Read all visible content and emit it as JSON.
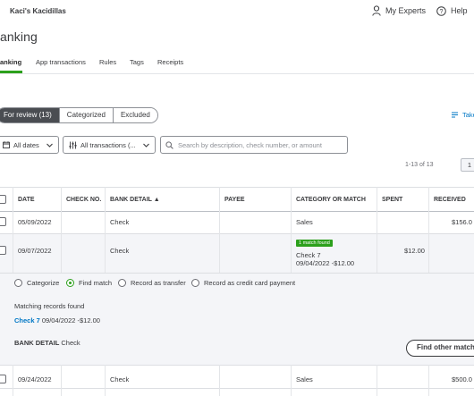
{
  "header": {
    "company": "Kaci's Kacidillas",
    "my_experts": "My Experts",
    "help": "Help"
  },
  "page": {
    "title": "anking"
  },
  "tabs": [
    {
      "label": "anking"
    },
    {
      "label": "App transactions"
    },
    {
      "label": "Rules"
    },
    {
      "label": "Tags"
    },
    {
      "label": "Receipts"
    }
  ],
  "segments": [
    {
      "label": "For review (13)"
    },
    {
      "label": "Categorized"
    },
    {
      "label": "Excluded"
    }
  ],
  "take_link": "Take",
  "filters": {
    "dates": "All dates",
    "transactions": "All transactions (...",
    "search_placeholder": "Search by description, check number, or amount"
  },
  "pager": {
    "text": "1-13 of 13",
    "page": "1"
  },
  "table": {
    "headers": [
      "DATE",
      "CHECK NO.",
      "BANK DETAIL ▲",
      "PAYEE",
      "CATEGORY OR MATCH",
      "SPENT",
      "RECEIVED"
    ],
    "rows": [
      {
        "date": "05/09/2022",
        "check_no": "",
        "bank_detail": "Check",
        "payee": "",
        "category": "Sales",
        "spent": "",
        "received": "$156.0"
      },
      {
        "date": "09/07/2022",
        "check_no": "",
        "bank_detail": "Check",
        "payee": "",
        "badge": "1 match found",
        "category": "Check 7",
        "category_sub": "09/04/2022 -$12.00",
        "spent": "$12.00",
        "received": ""
      },
      {
        "date": "09/24/2022",
        "check_no": "",
        "bank_detail": "Check",
        "payee": "",
        "category": "Sales",
        "spent": "",
        "received": "$500.0"
      }
    ]
  },
  "expanded": {
    "options": [
      "Categorize",
      "Find match",
      "Record as transfer",
      "Record as credit card payment"
    ],
    "selected": "Find match",
    "matching_title": "Matching records found",
    "match_link": "Check 7",
    "match_detail": "09/04/2022 -$12.00",
    "bank_detail_label": "BANK DETAIL",
    "bank_detail_value": "Check",
    "find_other": "Find other match"
  },
  "colors": {
    "accent": "#2ca01c",
    "link": "#0077c5",
    "text": "#393a3d",
    "segment_active": "#4a4d52"
  }
}
